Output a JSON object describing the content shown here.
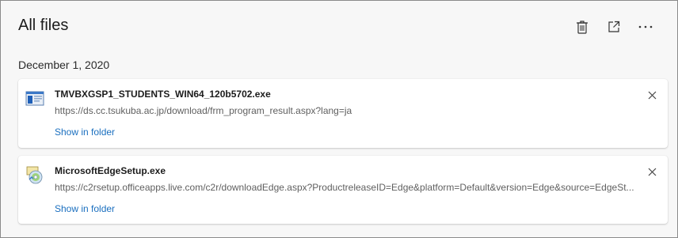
{
  "header": {
    "title": "All files",
    "icons": [
      "trash-icon",
      "open-external-icon",
      "more-icon"
    ]
  },
  "section": {
    "date": "December 1, 2020"
  },
  "downloads": [
    {
      "filename": "TMVBXGSP1_STUDENTS_WIN64_120b5702.exe",
      "url": "https://ds.cc.tsukuba.ac.jp/download/frm_program_result.aspx?lang=ja",
      "action": "Show in folder",
      "icon": "installer-window-icon"
    },
    {
      "filename": "MicrosoftEdgeSetup.exe",
      "url": "https://c2rsetup.officeapps.live.com/c2r/downloadEdge.aspx?ProductreleaseID=Edge&platform=Default&version=Edge&source=EdgeSt...",
      "action": "Show in folder",
      "icon": "setup-disc-icon"
    }
  ],
  "colors": {
    "link": "#1a6fbf",
    "background": "#f7f7f7",
    "card": "#ffffff"
  }
}
